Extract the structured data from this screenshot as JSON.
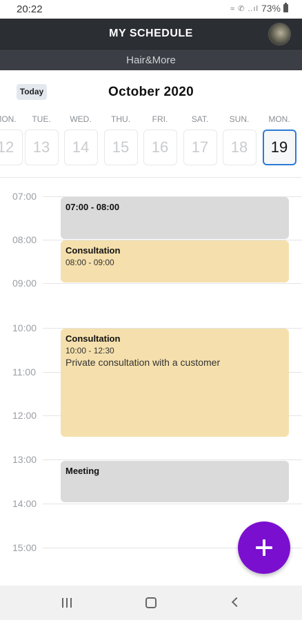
{
  "status_bar": {
    "time": "20:22",
    "battery": "73%",
    "icons": "wifi call signal"
  },
  "header": {
    "title": "MY SCHEDULE",
    "salon": "Hair&More"
  },
  "calendar": {
    "today_label": "Today",
    "month": "October 2020",
    "days": [
      {
        "label": "MON.",
        "number": "12"
      },
      {
        "label": "TUE.",
        "number": "13"
      },
      {
        "label": "WED.",
        "number": "14"
      },
      {
        "label": "THU.",
        "number": "15"
      },
      {
        "label": "FRI.",
        "number": "16"
      },
      {
        "label": "SAT.",
        "number": "17"
      },
      {
        "label": "SUN.",
        "number": "18"
      },
      {
        "label": "MON.",
        "number": "19",
        "selected": true
      }
    ]
  },
  "timeline": {
    "hours": [
      "07:00",
      "08:00",
      "09:00",
      "10:00",
      "11:00",
      "12:00",
      "13:00",
      "14:00",
      "15:00"
    ]
  },
  "events": [
    {
      "title": "07:00 - 08:00",
      "time": "",
      "description": "",
      "color": "gray"
    },
    {
      "title": "Consultation",
      "time": "08:00 - 09:00",
      "description": "",
      "color": "yellow"
    },
    {
      "title": "Consultation",
      "time": "10:00 - 12:30",
      "description": "Private consultation with a customer",
      "color": "yellow"
    },
    {
      "title": "Meeting",
      "time": "",
      "description": "",
      "color": "gray"
    }
  ],
  "colors": {
    "header": "#2b2e33",
    "fab": "#7b0fd0",
    "selected_day_border": "#2a7bd4",
    "event_gray": "#dadada",
    "event_yellow": "#f5e0ad"
  }
}
